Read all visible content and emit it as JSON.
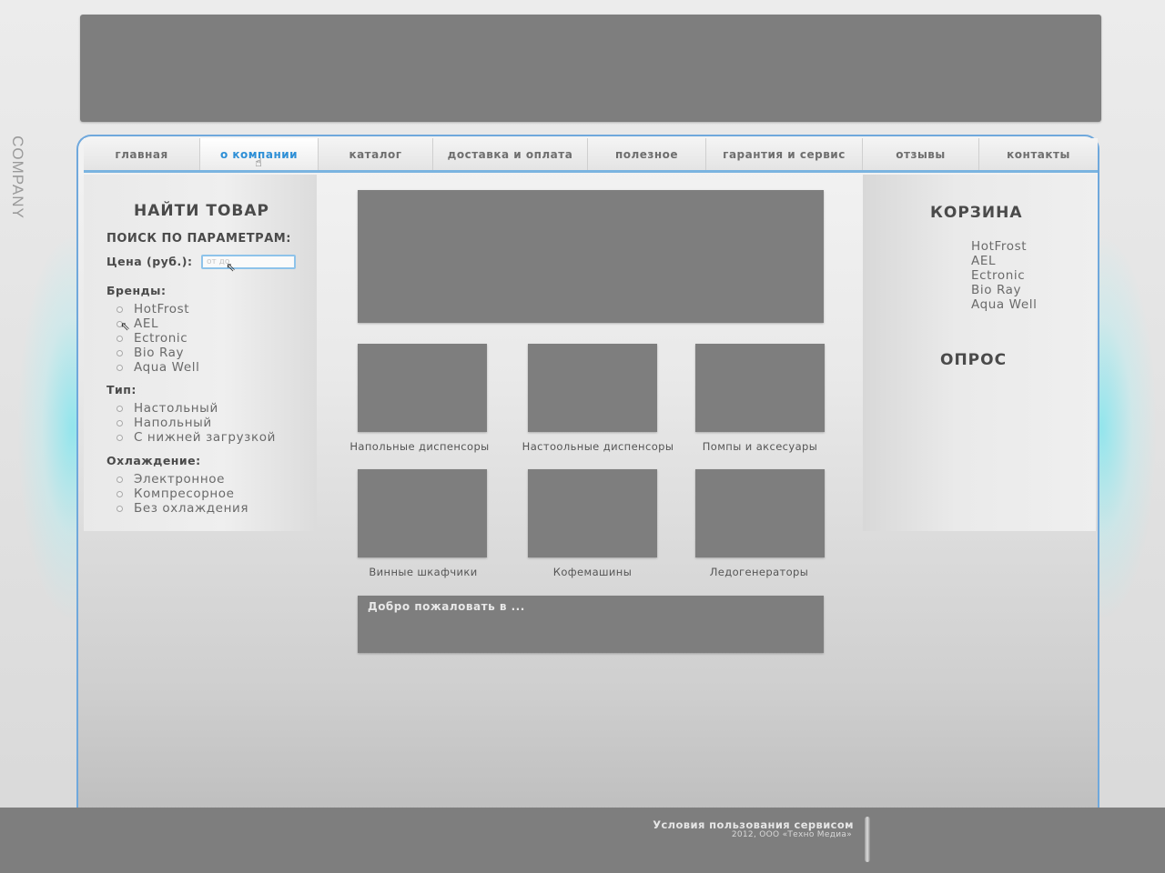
{
  "side_logo": "COMPANY",
  "nav": [
    {
      "label": "главная",
      "width": 128
    },
    {
      "label": "о компании",
      "width": 130,
      "active": true
    },
    {
      "label": "каталог",
      "width": 126
    },
    {
      "label": "доставка и оплата",
      "width": 170
    },
    {
      "label": "полезное",
      "width": 130
    },
    {
      "label": "гарантия и сервис",
      "width": 172
    },
    {
      "label": "отзывы",
      "width": 128
    },
    {
      "label": "контакты",
      "width": 130
    }
  ],
  "search": {
    "title": "НАЙТИ ТОВАР",
    "subtitle": "ПОИСК ПО ПАРАМЕТРАМ:",
    "price_label": "Цена (руб.):",
    "price_placeholder": "от    до",
    "brands_label": "Бренды:",
    "brands": [
      "HotFrost",
      "AEL",
      "Ectronic",
      "Bio Ray",
      "Aqua Well"
    ],
    "type_label": "Тип:",
    "types": [
      "Настольный",
      "Напольный",
      "С нижней загрузкой"
    ],
    "cooling_label": "Охлаждение:",
    "cooling": [
      "Электронное",
      "Компресорное",
      "Без охлаждения"
    ]
  },
  "cart": {
    "title": "КОРЗИНА",
    "items": [
      "HotFrost",
      "AEL",
      "Ectronic",
      "Bio Ray",
      "Aqua Well"
    ]
  },
  "poll": {
    "title": "ОПРОС"
  },
  "categories": [
    "Напольные диспенсоры",
    "Настоольные диспенсоры",
    "Помпы и аксесуары",
    "Винные шкафчики",
    "Кофемашины",
    "Ледогенераторы"
  ],
  "welcome": "Добро пожаловать в ...",
  "footer": {
    "terms": "Условия пользования сервисом",
    "copyright": "2012, ООО «Техно Медиа»"
  }
}
